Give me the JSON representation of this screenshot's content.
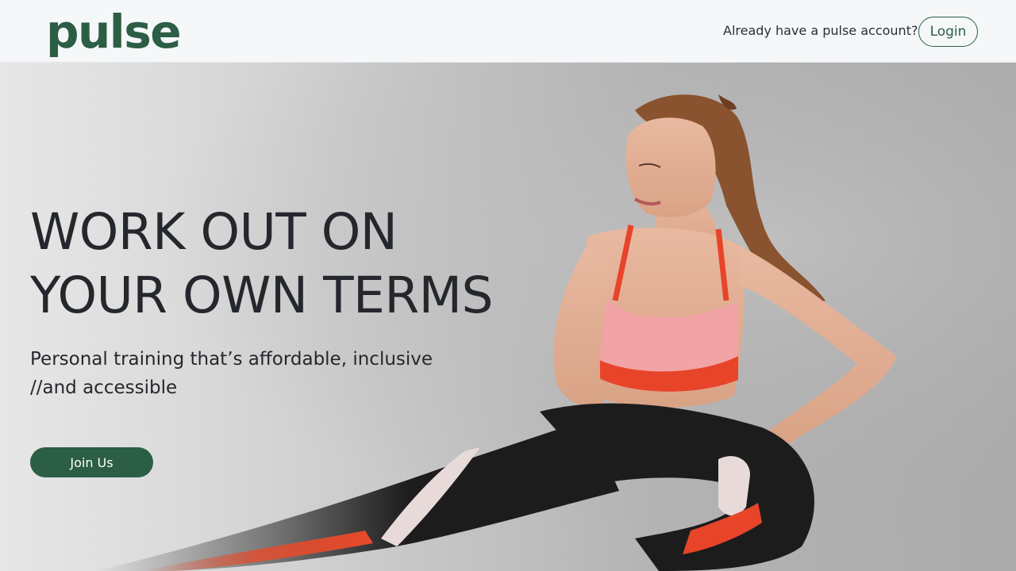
{
  "header": {
    "logo_text": "pulse",
    "account_question": "Already have a pulse account?",
    "login_label": "Login"
  },
  "hero": {
    "headline_line1": "WORK OUT ON",
    "headline_line2": "YOUR OWN TERMS",
    "subhead_line1": "Personal training that’s affordable, inclusive",
    "subhead_line2": "//and accessible",
    "cta_label": "Join Us",
    "image": "woman-stretching-photo"
  },
  "colors": {
    "brand": "#2b5e45",
    "text": "#24272c",
    "header_bg": "#f5f7f9"
  }
}
